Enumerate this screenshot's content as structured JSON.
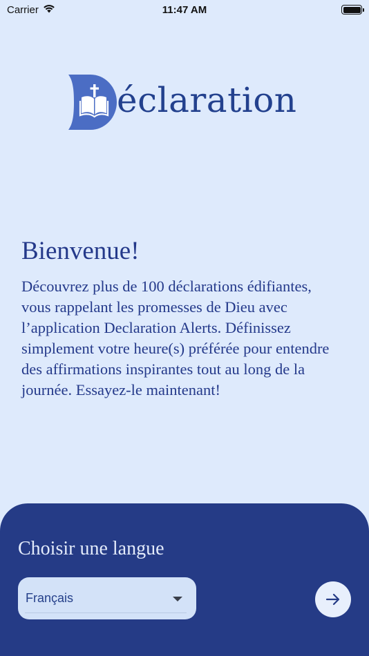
{
  "status_bar": {
    "carrier": "Carrier",
    "time": "11:47 AM",
    "icons": [
      "wifi-icon",
      "battery-icon"
    ]
  },
  "logo": {
    "text": "éclaration",
    "icon": "bible-cross-icon"
  },
  "welcome": {
    "title": "Bienvenue!",
    "body": "Découvrez plus de 100 déclarations édifiantes, vous rappelant les promesses de Dieu avec l’application Declaration Alerts. Définissez simplement votre heure(s) préférée pour entendre des affirmations inspirantes tout au long de la journée. Essayez-le maintenant!"
  },
  "language_panel": {
    "title": "Choisir une langue",
    "selected_language": "Français",
    "next_icon": "arrow-right-icon"
  },
  "colors": {
    "background": "#deeafc",
    "brand": "#23418e",
    "panel": "#253b86",
    "select_bg": "#d3e2f8"
  }
}
